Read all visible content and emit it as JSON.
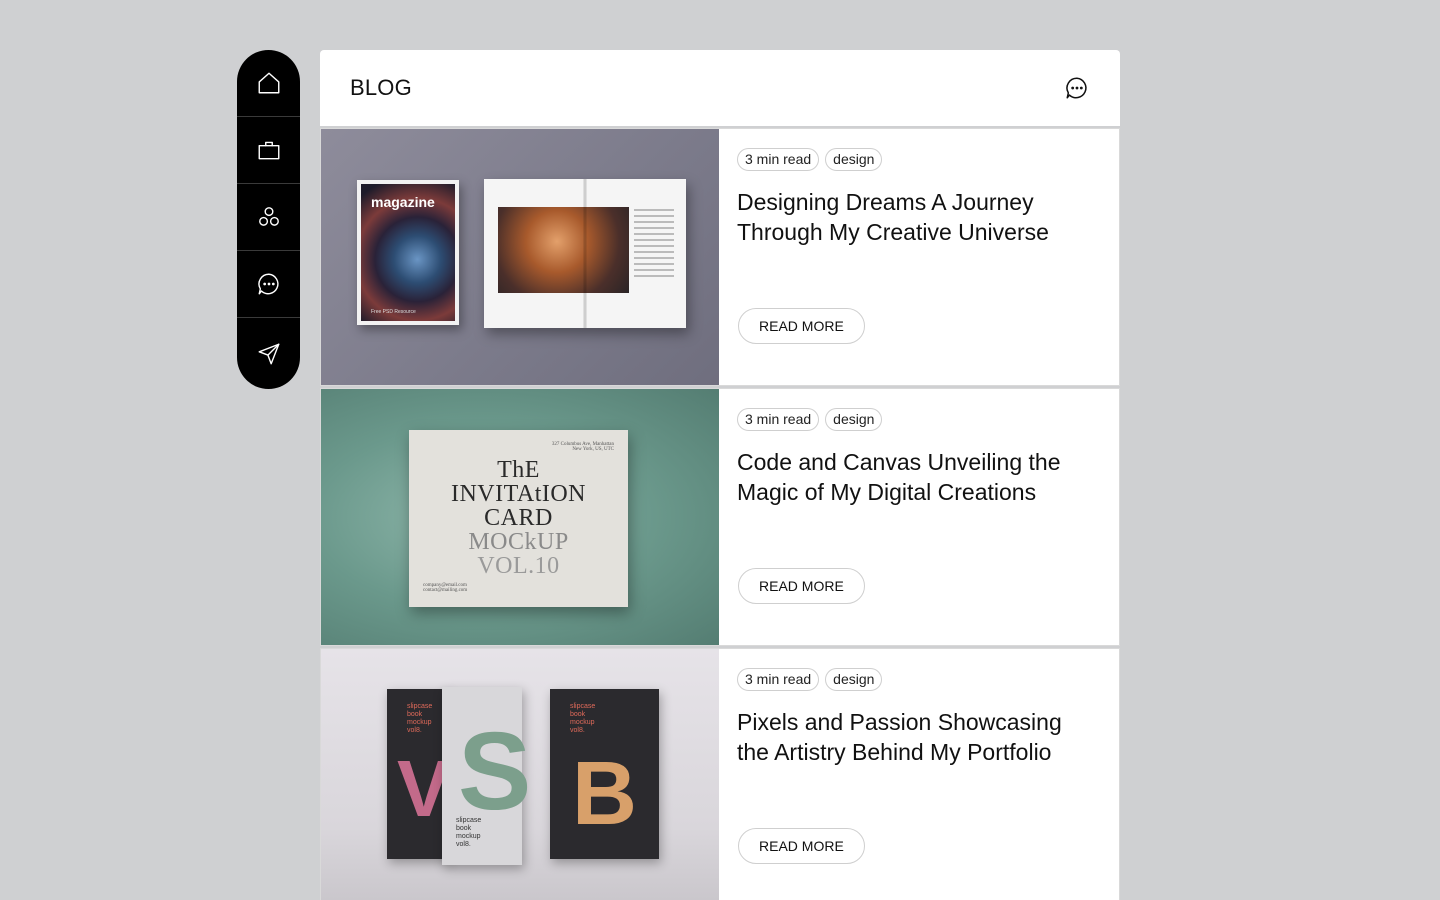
{
  "sidebar": {
    "items": [
      {
        "icon": "home-icon",
        "name": "sidebar-item-home"
      },
      {
        "icon": "briefcase-icon",
        "name": "sidebar-item-portfolio"
      },
      {
        "icon": "circles-icon",
        "name": "sidebar-item-services"
      },
      {
        "icon": "chat-icon",
        "name": "sidebar-item-blog"
      },
      {
        "icon": "send-icon",
        "name": "sidebar-item-contact"
      }
    ]
  },
  "header": {
    "title": "BLOG",
    "icon": "chat-icon"
  },
  "posts": [
    {
      "read_time": "3 min read",
      "tag": "design",
      "title": "Designing Dreams A Journey Through My Creative Universe",
      "button": "READ MORE",
      "image": {
        "cover_title": "magazine",
        "cover_small": "Free PSD Resource"
      }
    },
    {
      "read_time": "3 min read",
      "tag": "design",
      "title": "Code and Canvas Unveiling the Magic of My Digital Creations",
      "button": "READ MORE",
      "image": {
        "card_line1": "ThE",
        "card_line2": "INVITAtION",
        "card_line3": "CARD",
        "card_line4": "MOCkUP",
        "card_line5": "VOL.10"
      }
    },
    {
      "read_time": "3 min read",
      "tag": "design",
      "title": "Pixels and Passion Showcasing the Artistry Behind My Portfolio",
      "button": "READ MORE",
      "image": {
        "book_label": "slipcase book mockup vol8."
      }
    }
  ]
}
